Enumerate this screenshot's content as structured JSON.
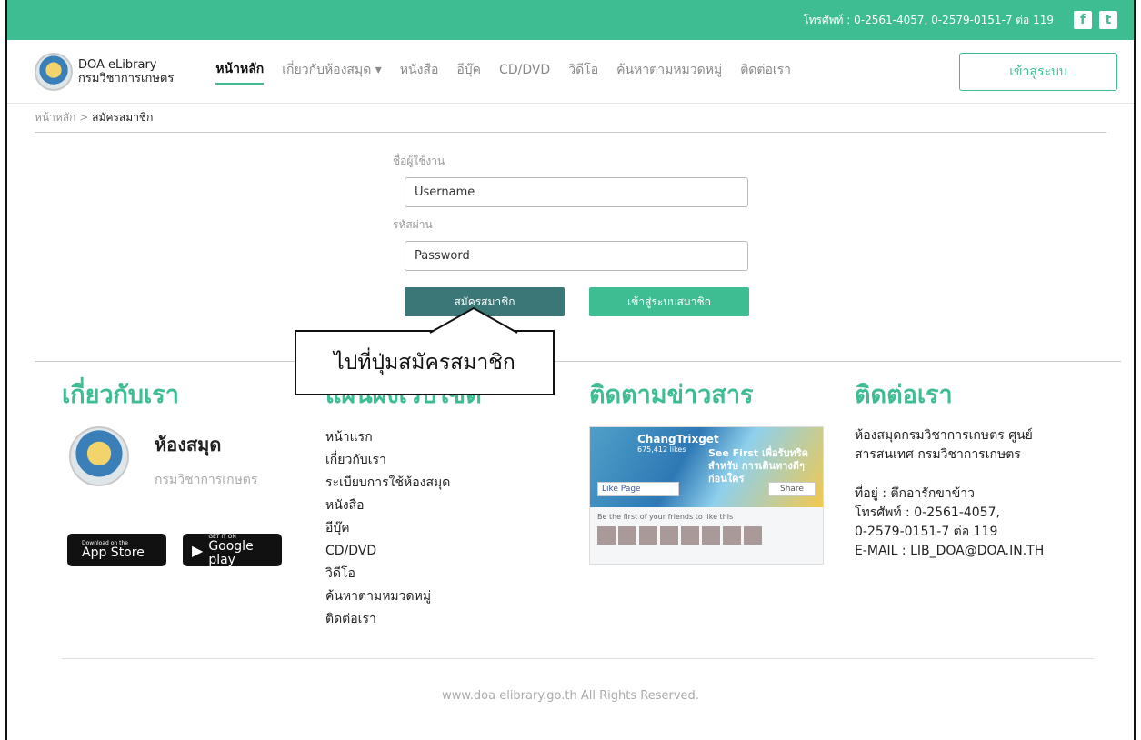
{
  "topbar": {
    "phone": "โทรศัพท์ : 0-2561-4057, 0-2579-0151-7 ต่อ 119",
    "facebook_glyph": "f",
    "twitter_glyph": "t"
  },
  "logo": {
    "line1": "DOA eLibrary",
    "line2": "กรมวิชาการเกษตร"
  },
  "nav": [
    {
      "label": "หน้าหลัก"
    },
    {
      "label": "เกี่ยวกับห้องสมุด ▾"
    },
    {
      "label": "หนังสือ"
    },
    {
      "label": "อีบุ๊ค"
    },
    {
      "label": "CD/DVD"
    },
    {
      "label": "วิดีโอ"
    },
    {
      "label": "ค้นหาตามหมวดหมู่"
    },
    {
      "label": "ติดต่อเรา"
    }
  ],
  "login_button": "เข้าสู่ระบบ",
  "breadcrumb": {
    "home": "หน้าหลัก >",
    "current": "สมัครสมาชิก"
  },
  "form": {
    "username_label": "ชื่อผู้ใช้งาน",
    "username_placeholder": "Username",
    "password_label": "รหัสผ่าน",
    "password_placeholder": "Password",
    "register_button": "สมัครสมาชิก",
    "member_login_button": "เข้าสู่ระบบสมาชิก"
  },
  "callout": "ไปที่ปุ่มสมัครสมาชิก",
  "footer": {
    "about": {
      "title": "เกี่ยวกับเรา",
      "lib_name": "ห้องสมุด",
      "lib_dept": "กรมวิชาการเกษตร"
    },
    "stores": [
      {
        "small": "Download on the",
        "big": "App Store",
        "icon": ""
      },
      {
        "small": "GET IT ON",
        "big": "Google play",
        "icon": "▶"
      }
    ],
    "sitemap": {
      "title": "แผนผังเว็บไซต์",
      "items": [
        "หน้าแรก",
        "เกี่ยวกับเรา",
        "ระเบียบการใช้ห้องสมุด",
        "หนังสือ",
        "อีบุ๊ค",
        "CD/DVD",
        "วิดีโอ",
        "ค้นหาตามหมวดหมู่",
        "ติดต่อเรา"
      ]
    },
    "news": {
      "title": "ติดตามข่าวสาร",
      "fb_name": "ChangTrixget",
      "fb_likes": "675,412 likes",
      "fb_promo": "See First เพื่อรับทริคสำหรับ การเดินทางดีๆ ก่อนใคร",
      "fb_like": "Like Page",
      "fb_share": "Share",
      "fb_sub": "Be the first of your friends to like this"
    },
    "contact": {
      "title": "ติดต่อเรา",
      "lines1": [
        "ห้องสมุดกรมวิชาการเกษตร ศูนย์",
        "สารสนเทศ กรมวิชาการเกษตร"
      ],
      "lines2": [
        "ที่อยู่ : ตึกอารักขาข้าว",
        "โทรศัพท์ : 0-2561-4057,",
        "0-2579-0151-7 ต่อ 119",
        "E-MAIL : LIB_DOA@DOA.IN.TH"
      ]
    }
  },
  "copyright": "www.doa elibrary.go.th All Rights Reserved."
}
